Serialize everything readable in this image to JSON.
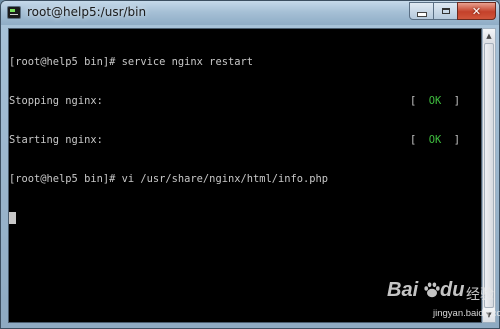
{
  "window": {
    "title": "root@help5:/usr/bin",
    "controls": {
      "minimize_icon": "minimize-icon",
      "maximize_icon": "maximize-icon",
      "close_label": "✕"
    }
  },
  "terminal": {
    "lines": [
      {
        "text": "[root@help5 bin]# service nginx restart"
      },
      {
        "text": "Stopping nginx:",
        "status_open": "[  ",
        "status": "OK",
        "status_close": "  ]"
      },
      {
        "text": "Starting nginx:",
        "status_open": "[  ",
        "status": "OK",
        "status_close": "  ]"
      },
      {
        "text": "[root@help5 bin]# vi /usr/share/nginx/html/info.php"
      }
    ],
    "colors": {
      "background": "#000000",
      "foreground": "#c8c8c8",
      "ok": "#3ebc3e"
    }
  },
  "scrollbar": {
    "up_icon": "▲",
    "down_icon": "▼"
  },
  "watermark": {
    "brand_left": "Bai",
    "brand_right": "du",
    "product": "经验",
    "url": "jingyan.baidu.com"
  }
}
